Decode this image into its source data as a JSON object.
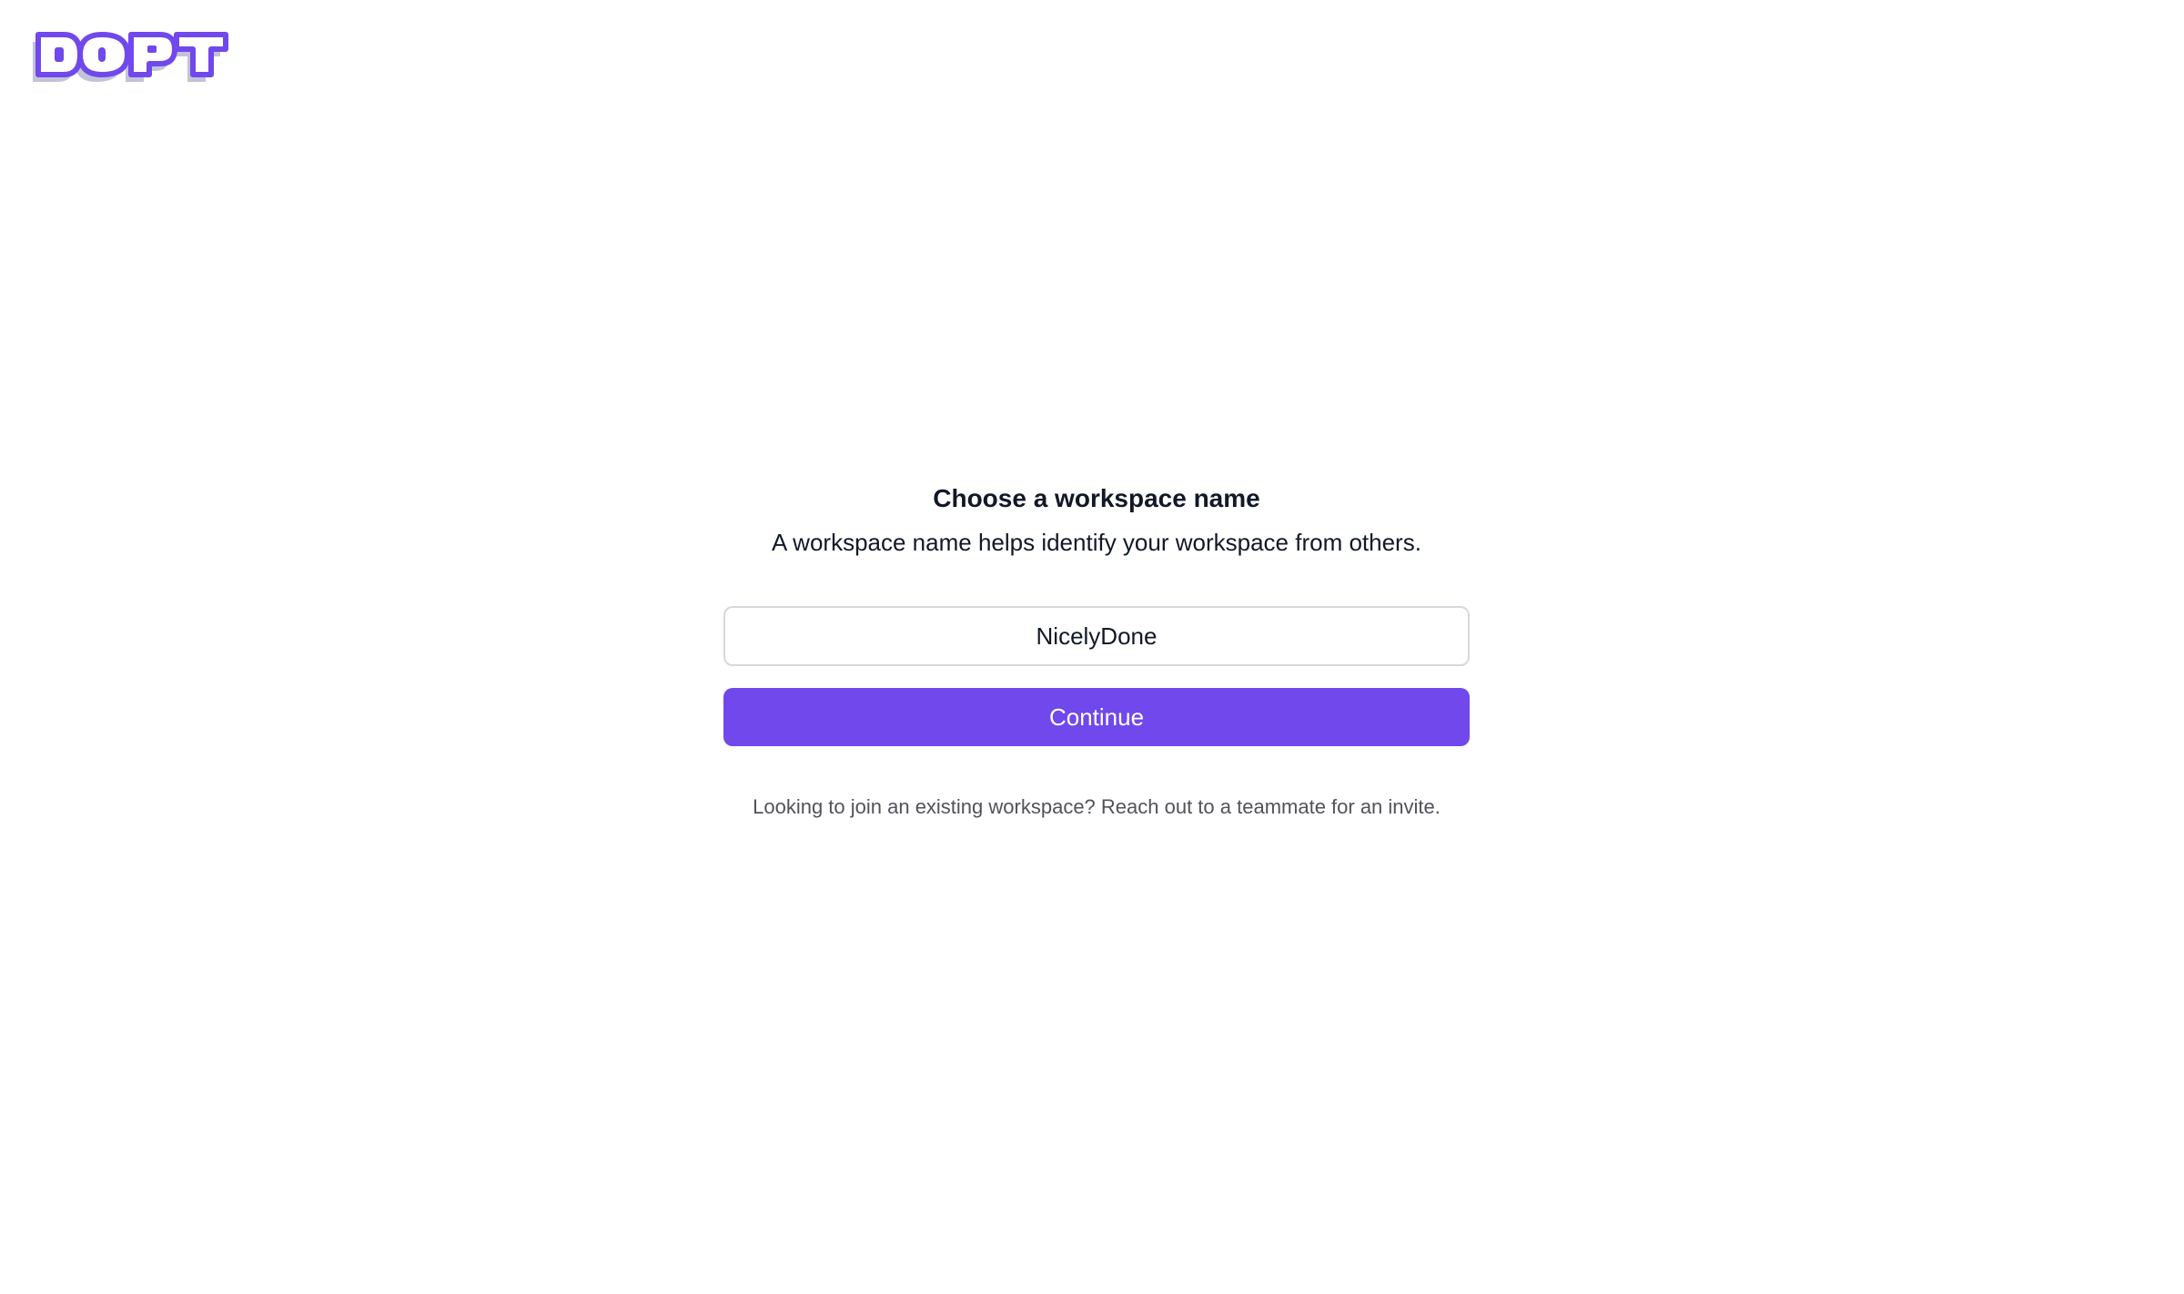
{
  "brand": {
    "logo_text": "DOPT",
    "primary_color": "#7148ec",
    "shadow_color": "#c2c3d9"
  },
  "form": {
    "title": "Choose a workspace name",
    "subtitle": "A workspace name helps identify your workspace from others.",
    "workspace_name_value": "NicelyDone",
    "continue_label": "Continue",
    "hint": "Looking to join an existing workspace? Reach out to a teammate for an invite."
  }
}
